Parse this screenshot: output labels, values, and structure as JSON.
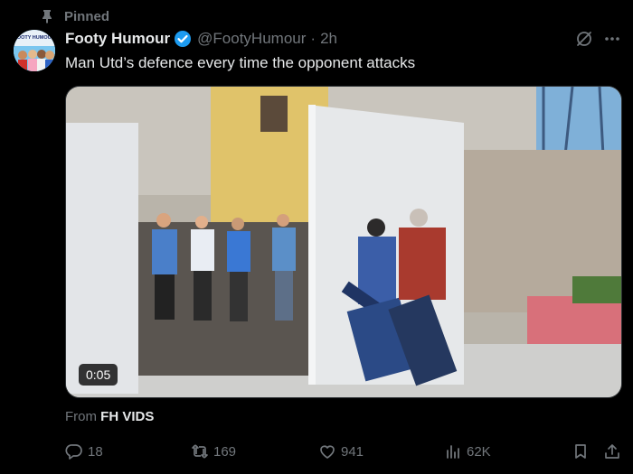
{
  "pinned": {
    "label": "Pinned",
    "icon": "pin-icon"
  },
  "author": {
    "avatar_text": "FOOTY HUMOUR",
    "name": "Footy Humour",
    "handle": "@FootyHumour",
    "separator": "·",
    "time": "2h",
    "verified_icon": "verified-badge-icon"
  },
  "tweet": {
    "text": "Man Utd’s defence every time the opponent attacks"
  },
  "media": {
    "duration": "0:05"
  },
  "source": {
    "prefix": "From",
    "name": "FH VIDS"
  },
  "actions": {
    "replies": "18",
    "reposts": "169",
    "likes": "941",
    "views": "62K"
  },
  "colors": {
    "background": "#000000",
    "text": "#e7e9ea",
    "muted": "#71767b",
    "verified": "#1d9bf0"
  }
}
